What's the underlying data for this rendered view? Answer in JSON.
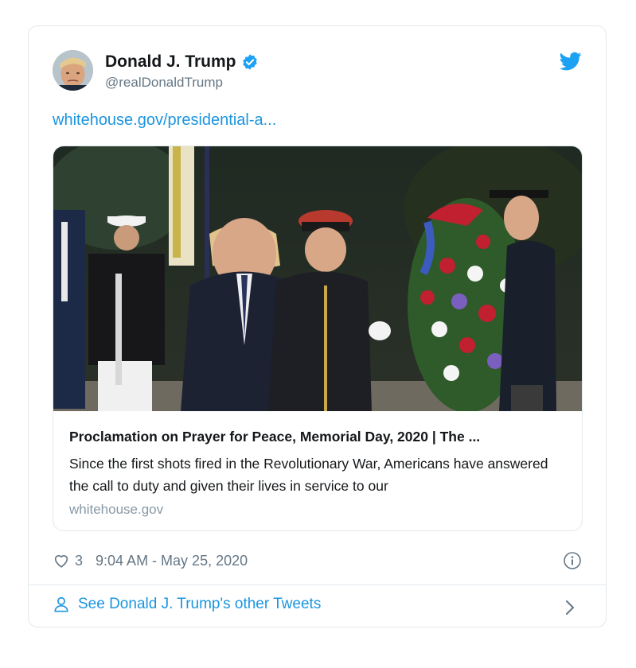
{
  "tweet": {
    "author": {
      "display_name": "Donald J. Trump",
      "handle": "@realDonaldTrump",
      "verified": true
    },
    "link_text": "whitehouse.gov/presidential-a...",
    "card": {
      "title": "Proclamation on Prayer for Peace, Memorial Day, 2020 | The ...",
      "description": "Since the first shots fired in the Revolutionary War, Americans have answered the call to duty and given their lives in service to our",
      "domain": "whitehouse.gov",
      "image_icon": "photo-memorial-wreath"
    },
    "likes": "3",
    "timestamp": "9:04 AM - May 25, 2020",
    "footer_link": "See Donald J. Trump's other Tweets"
  },
  "icons": {
    "brand": "twitter-bird-icon",
    "verified": "verified-badge-icon",
    "like": "heart-icon",
    "info": "info-icon",
    "profile": "person-icon",
    "chevron": "chevron-right-icon"
  },
  "colors": {
    "accent": "#1b95e0",
    "verified": "#1da1f2",
    "muted": "#657786",
    "border": "#e1e8ed"
  }
}
